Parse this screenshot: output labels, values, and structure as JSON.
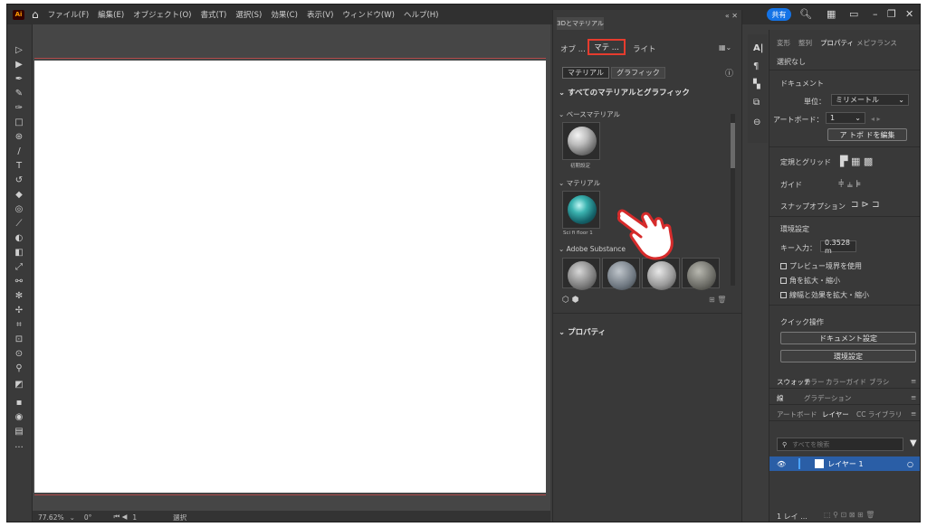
{
  "menubar": {
    "logo": "Ai",
    "items": [
      "ファイル(F)",
      "編集(E)",
      "オブジェクト(O)",
      "書式(T)",
      "選択(S)",
      "効果(C)",
      "表示(V)",
      "ウィンドウ(W)",
      "ヘルプ(H)"
    ],
    "share_label": "共有"
  },
  "panel3d": {
    "title": "3Dとマテリアル",
    "tabs": [
      "オブ ...",
      "マテ ...",
      "ライト"
    ],
    "seg_buttons": [
      "マテリアル",
      "グラフィック"
    ],
    "section_all": "すべてのマテリアルとグラフィック",
    "base_material": "ベースマテリアル",
    "base_item": "初期設定",
    "material": "マテリアル",
    "material_item": "Sci fi floor 1",
    "adobe_substance": "Adobe Substance",
    "properties": "プロパティ"
  },
  "props": {
    "tabs": [
      "変形",
      "整列",
      "プロパティ",
      "メピフランス"
    ],
    "no_selection": "選択なし",
    "document": "ドキュメント",
    "units_label": "単位：",
    "units_value": "ミリメートル",
    "artboard_label": "アートボード：",
    "artboard_value": "1",
    "edit_artboard": "ア トボ ドを編集",
    "rulers_grid": "定規とグリッド",
    "guides": "ガイド",
    "snap": "スナップオプション",
    "env": "環境設定",
    "key_input_label": "キー入力：",
    "key_input_value": "0.3528 m",
    "preview_bounds": "プレビュー境界を使用",
    "scale_corners": "角を拡大・縮小",
    "scale_strokes": "線幅と効果を拡大・縮小",
    "quick_actions": "クイック操作",
    "doc_setup": "ドキュメント設定",
    "pref_btn": "環境設定"
  },
  "layers": {
    "row1": [
      "スウォッチ",
      "カラー",
      "カラーガイド",
      "ブラシ"
    ],
    "row2": [
      "線",
      "グラデーション"
    ],
    "row3": [
      "アートボード",
      "レイヤー",
      "CC ライブラリ"
    ],
    "search_placeholder": "すべてを検索",
    "layer_name": "レイヤー 1",
    "footer": "1 レイ ..."
  },
  "status": {
    "zoom": "77.62%",
    "rotation": "0°",
    "page": "1",
    "mode": "選択"
  },
  "colors": {
    "accent_red": "#e63c2e",
    "share_blue": "#1473e6",
    "layer_sel": "#2a5ea6"
  }
}
